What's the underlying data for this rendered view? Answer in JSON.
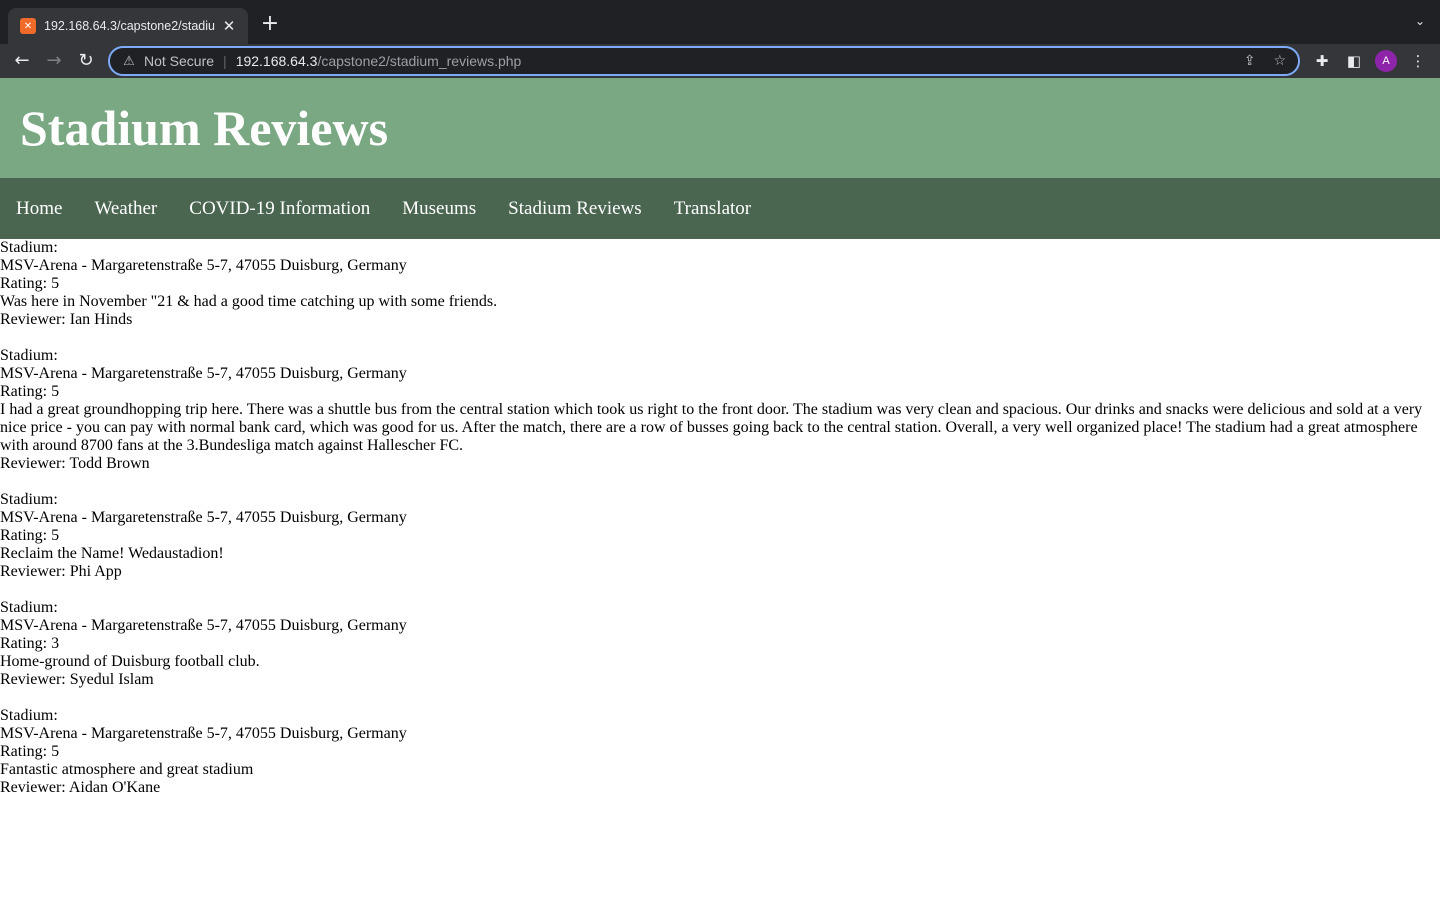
{
  "browser": {
    "tab_title": "192.168.64.3/capstone2/stadiu",
    "favicon_letter": "✕",
    "not_secure_label": "Not Secure",
    "url_host": "192.168.64.3",
    "url_path": "/capstone2/stadium_reviews.php",
    "profile_initial": "A"
  },
  "site": {
    "title": "Stadium Reviews"
  },
  "nav": {
    "items": [
      {
        "label": "Home"
      },
      {
        "label": "Weather"
      },
      {
        "label": "COVID-19 Information"
      },
      {
        "label": "Museums"
      },
      {
        "label": "Stadium Reviews"
      },
      {
        "label": "Translator"
      }
    ]
  },
  "reviews": [
    {
      "stadium_label": "Stadium:",
      "stadium": "MSV-Arena - Margaretenstraße 5-7, 47055 Duisburg, Germany",
      "rating": "Rating: 5",
      "text": "Was here in November \"21 & had a good time catching up with some friends.",
      "reviewer": "Reviewer: Ian Hinds"
    },
    {
      "stadium_label": "Stadium:",
      "stadium": "MSV-Arena - Margaretenstraße 5-7, 47055 Duisburg, Germany",
      "rating": "Rating: 5",
      "text": "I had a great groundhopping trip here. There was a shuttle bus from the central station which took us right to the front door. The stadium was very clean and spacious. Our drinks and snacks were delicious and sold at a very nice price - you can pay with normal bank card, which was good for us. After the match, there are a row of busses going back to the central station. Overall, a very well organized place! The stadium had a great atmosphere with around 8700 fans at the 3.Bundesliga match against Hallescher FC.",
      "reviewer": "Reviewer: Todd Brown"
    },
    {
      "stadium_label": "Stadium:",
      "stadium": "MSV-Arena - Margaretenstraße 5-7, 47055 Duisburg, Germany",
      "rating": "Rating: 5",
      "text": "Reclaim the Name! Wedaustadion!",
      "reviewer": "Reviewer: Phi App"
    },
    {
      "stadium_label": "Stadium:",
      "stadium": "MSV-Arena - Margaretenstraße 5-7, 47055 Duisburg, Germany",
      "rating": "Rating: 3",
      "text": "Home-ground of Duisburg football club.",
      "reviewer": "Reviewer: Syedul Islam"
    },
    {
      "stadium_label": "Stadium:",
      "stadium": "MSV-Arena - Margaretenstraße 5-7, 47055 Duisburg, Germany",
      "rating": "Rating: 5",
      "text": "Fantastic atmosphere and great stadium",
      "reviewer": "Reviewer: Aidan O'Kane"
    }
  ]
}
